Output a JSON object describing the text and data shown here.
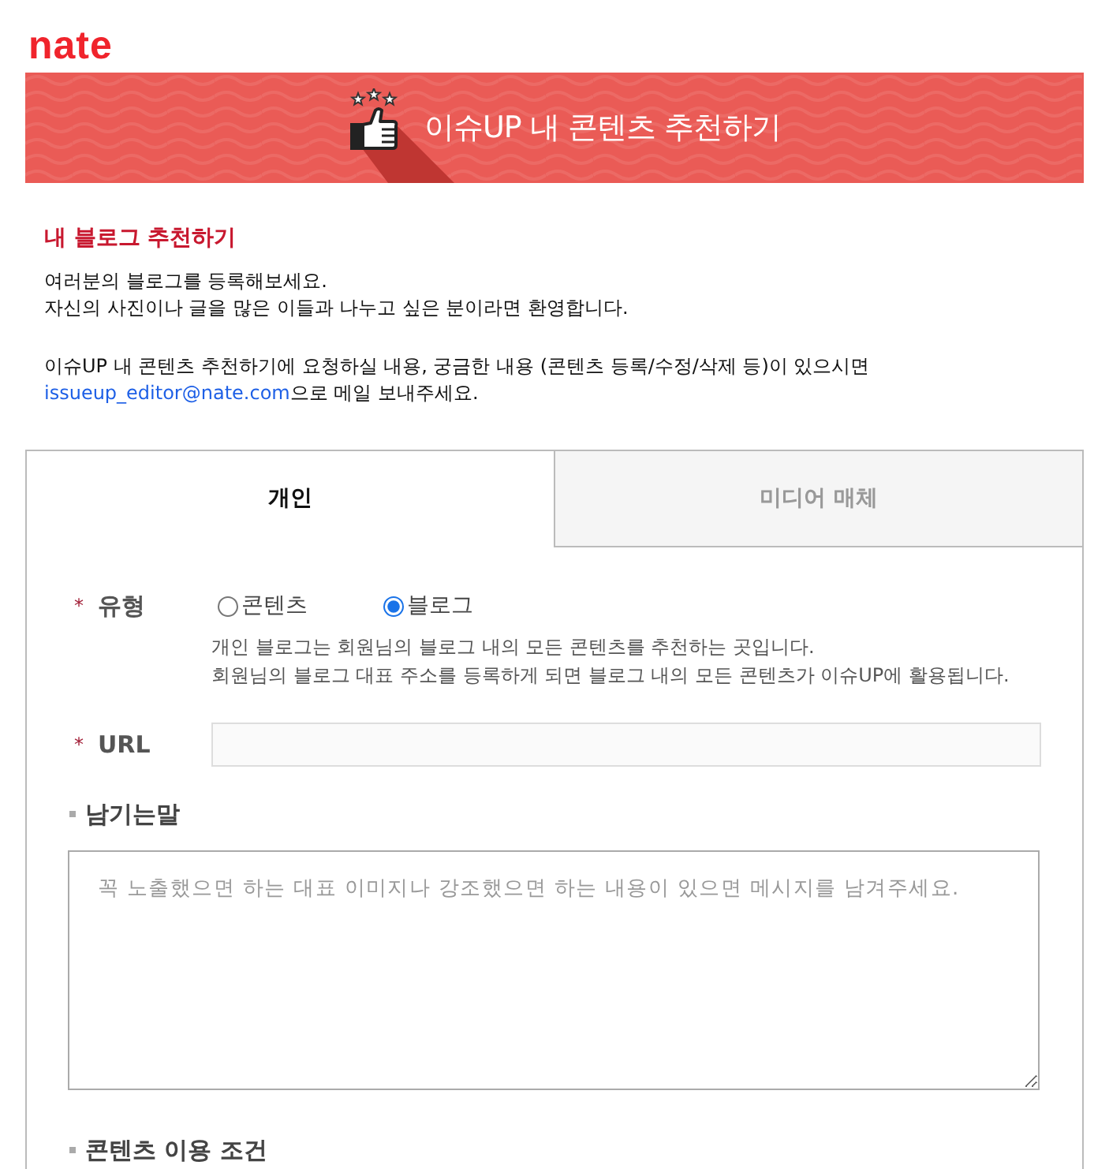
{
  "logo": {
    "text": "nate"
  },
  "banner": {
    "title": "이슈UP 내 콘텐츠 추천하기"
  },
  "intro": {
    "heading": "내 블로그 추천하기",
    "lines": [
      "여러분의 블로그를 등록해보세요.",
      "자신의 사진이나 글을 많은 이들과 나누고 싶은 분이라면 환영합니다."
    ],
    "contact": {
      "text": "이슈UP 내 콘텐츠 추천하기에 요청하실 내용, 궁금한 내용 (콘텐츠 등록/수정/삭제 등)이 있으시면",
      "email": "issueup_editor@nate.com",
      "suffix": "으로 메일 보내주세요."
    }
  },
  "tabs": [
    {
      "label": "개인",
      "selected": true
    },
    {
      "label": "미디어 매체",
      "selected": false
    }
  ],
  "form": {
    "type": {
      "required_mark": "*",
      "label": "유형",
      "options": [
        {
          "label": "콘텐츠",
          "selected": false
        },
        {
          "label": "블로그",
          "selected": true
        }
      ],
      "description": [
        "개인 블로그는 회원님의 블로그 내의 모든 콘텐츠를 추천하는 곳입니다.",
        "회원님의 블로그 대표 주소를 등록하게 되면 블로그 내의 모든 콘텐츠가 이슈UP에 활용됩니다."
      ]
    },
    "url": {
      "required_mark": "*",
      "label": "URL"
    },
    "message": {
      "heading": "남기는말",
      "placeholder": "꼭 노출했으면 하는 대표 이미지나 강조했으면 하는 내용이 있으면 메시지를 남겨주세요."
    },
    "terms": {
      "heading": "콘텐츠 이용 조건"
    }
  }
}
